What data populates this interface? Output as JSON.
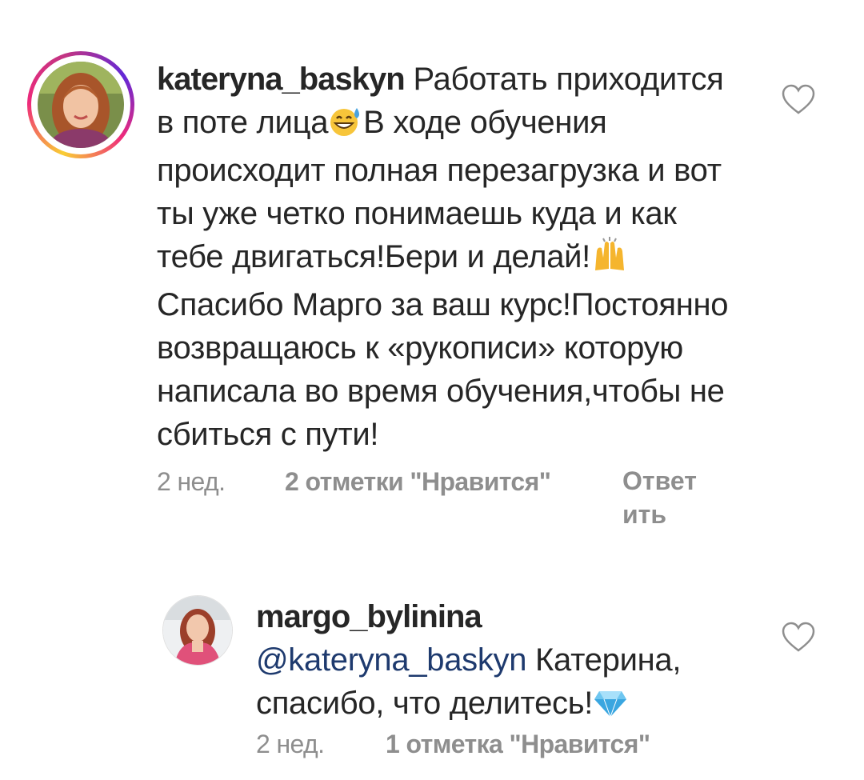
{
  "comments": [
    {
      "username": "kateryna_baskyn",
      "text_1": " Работать приходится в поте лица",
      "emoji_1": "grinning-sweat-emoji",
      "text_2": "В ходе обучения происходит полная перезагрузка и вот ты уже четко понимаешь куда и как тебе двигаться!Бери и делай!",
      "emoji_2": "raising-hands-emoji",
      "text_3": "Спасибо Марго за ваш курс!Постоянно возвращаюсь к «рукописи» которую написала во время обучения,чтобы не сбиться с пути!",
      "time": "2 нед.",
      "likes": "2 отметки \"Нравится\"",
      "reply": "Ответить"
    },
    {
      "username": "margo_bylinina",
      "mention": " @kateryna_baskyn",
      "text_1": " Катерина, спасибо, что делитесь!",
      "emoji_1": "gem-emoji",
      "time": "2 нед.",
      "likes": "1 отметка \"Нравится\""
    }
  ],
  "colors": {
    "text": "#262626",
    "meta": "#8e8e8e",
    "mention": "#1e3a6e",
    "heart_outline": "#8e8e8e"
  }
}
